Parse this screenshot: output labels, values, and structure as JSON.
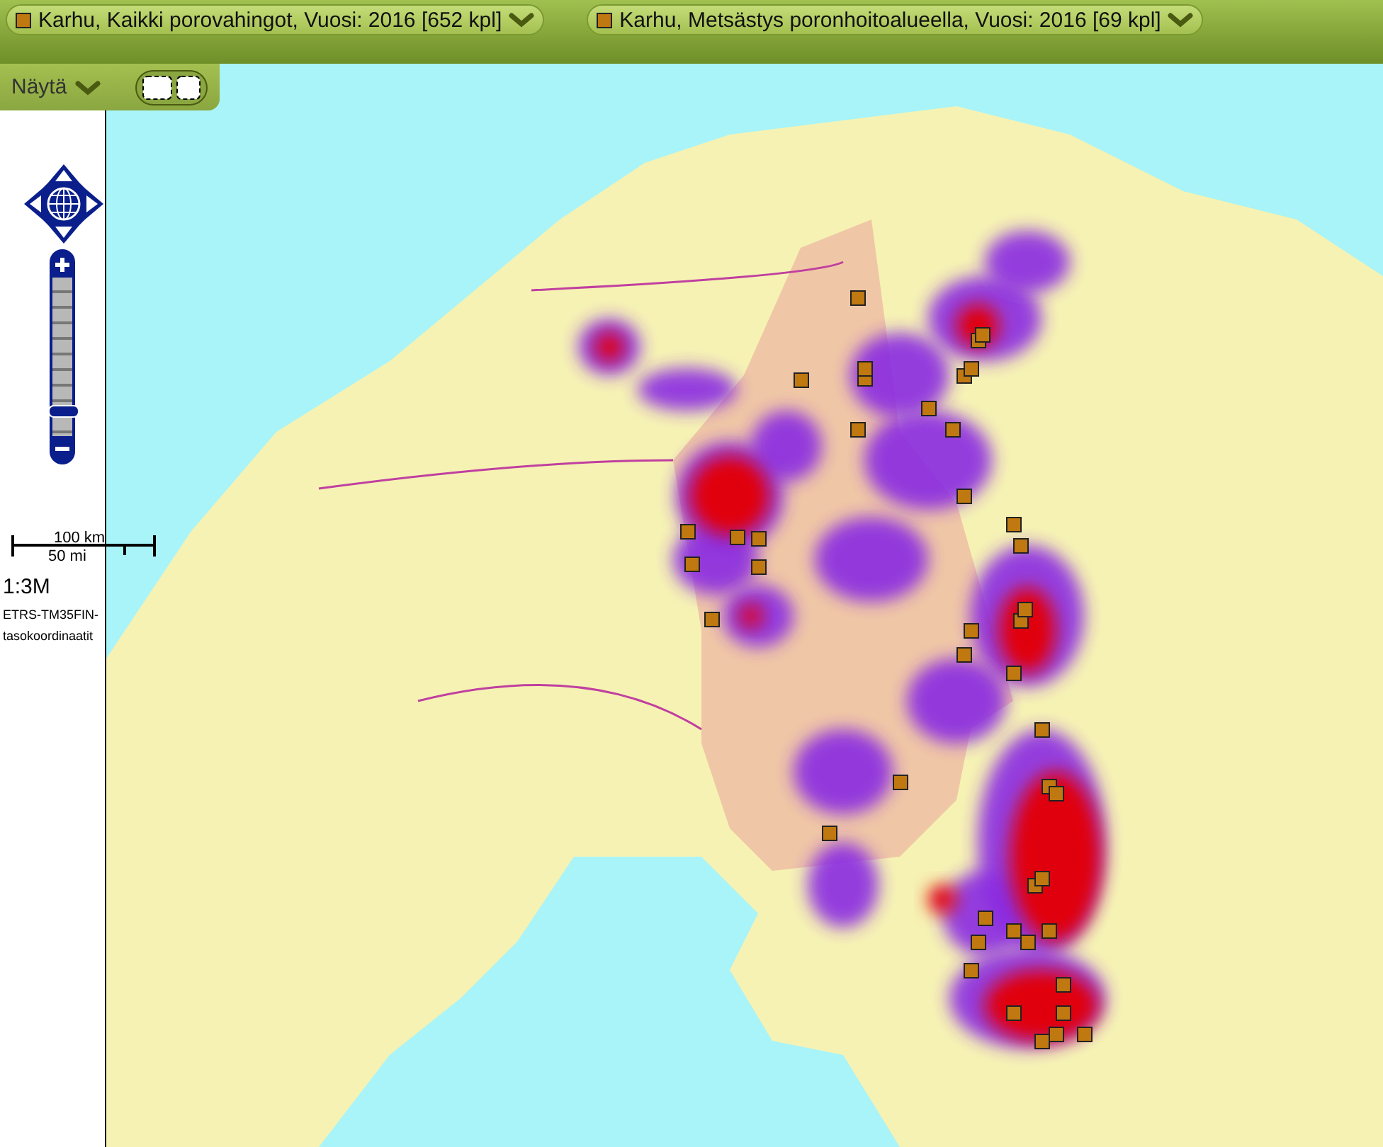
{
  "layers": [
    {
      "label": "Karhu, Kaikki porovahingot, Vuosi: 2016 [652 kpl]"
    },
    {
      "label": "Karhu, Metsästys poronhoitoalueella, Vuosi: 2016 [69 kpl]"
    }
  ],
  "show_menu": {
    "label": "Näytä"
  },
  "zoom": {
    "level": 0.15
  },
  "scale": {
    "km": "100 km",
    "mi": "50 mi",
    "ratio": "1:3M",
    "projection": "ETRS-TM35FIN-tasokoordinaatit"
  }
}
